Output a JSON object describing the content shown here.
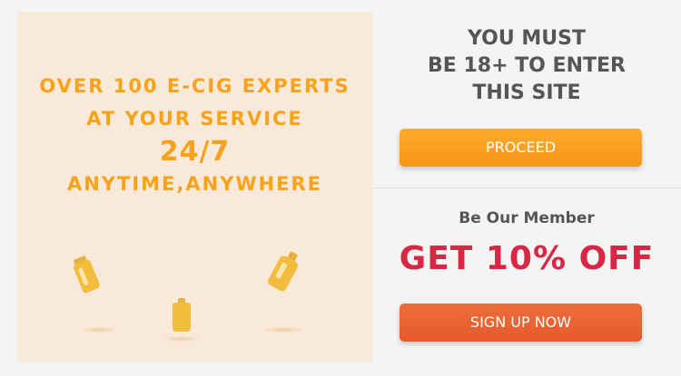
{
  "promo": {
    "line1": "OVER 100 E-CIG EXPERTS",
    "line2": "AT YOUR SERVICE",
    "line3": "24/7",
    "line4": "ANYTIME,ANYWHERE",
    "icons": [
      "e-cig-device-icon",
      "e-cig-device-icon",
      "e-cig-device-icon"
    ],
    "accent_color": "#f7a21b",
    "background_color": "#f9e9d8"
  },
  "age_gate": {
    "line1": "YOU MUST",
    "line2": "BE 18+ TO ENTER",
    "line3": "THIS SITE",
    "proceed_label": "PROCEED",
    "button_color": "#f79617"
  },
  "membership": {
    "title": "Be Our Member",
    "offer": "GET 10% OFF",
    "signup_label": "SIGN UP NOW",
    "offer_color": "#d72745",
    "button_color": "#e65a2c"
  }
}
